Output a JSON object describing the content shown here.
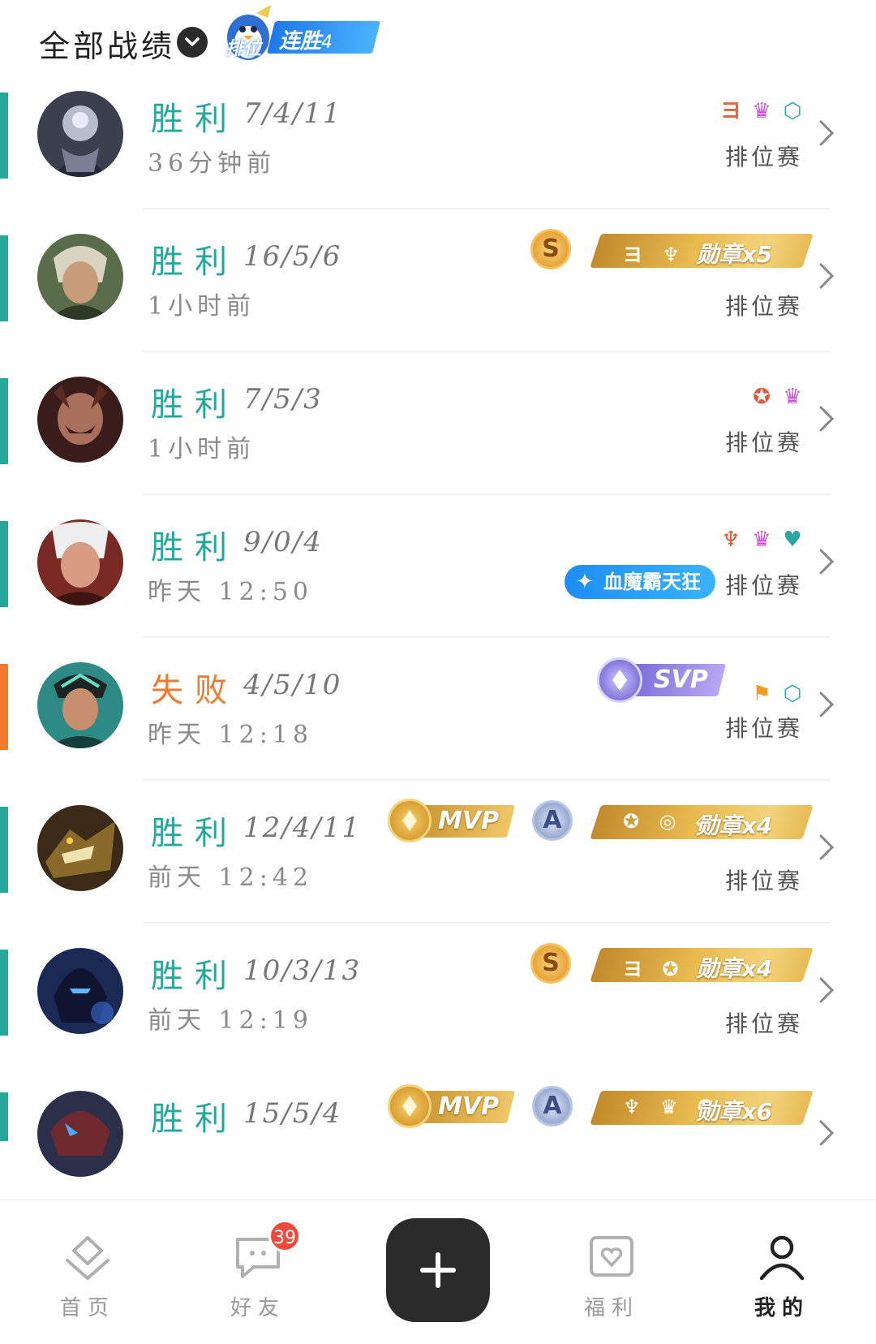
{
  "header": {
    "title": "全部战绩",
    "streak_rank_label": "排位",
    "streak_label": "连胜",
    "streak_count": "4"
  },
  "colors": {
    "win": "#25a89a",
    "loss": "#ef7a2e",
    "accent_gold": "#e7b44a",
    "title_pill": "#2a9df5"
  },
  "matches": [
    {
      "result": "胜利",
      "kda": "7/4/11",
      "time": "36分钟前",
      "mode": "排位赛",
      "outcome": "win",
      "small_icons": [
        "ヨ",
        "♛",
        "⬡"
      ],
      "grade": null,
      "medal": null,
      "mvp": null,
      "svp": null,
      "title": null
    },
    {
      "result": "胜利",
      "kda": "16/5/6",
      "time": "1小时前",
      "mode": "排位赛",
      "outcome": "win",
      "small_icons": [],
      "grade": "S",
      "medal": "勋章x5",
      "medal_icons": "ヨ ♆ ✪",
      "mvp": null,
      "svp": null,
      "title": null
    },
    {
      "result": "胜利",
      "kda": "7/5/3",
      "time": "1小时前",
      "mode": "排位赛",
      "outcome": "win",
      "small_icons": [
        "✪",
        "♛"
      ],
      "grade": null,
      "medal": null,
      "mvp": null,
      "svp": null,
      "title": null
    },
    {
      "result": "胜利",
      "kda": "9/0/4",
      "time": "昨天 12:50",
      "mode": "排位赛",
      "outcome": "win",
      "small_icons": [
        "♆",
        "♛",
        "♥"
      ],
      "grade": null,
      "medal": null,
      "mvp": null,
      "svp": null,
      "title": "血魔霸天狂"
    },
    {
      "result": "失败",
      "kda": "4/5/10",
      "time": "昨天 12:18",
      "mode": "排位赛",
      "outcome": "loss",
      "small_icons": [
        "⚑",
        "⬡"
      ],
      "grade": null,
      "medal": null,
      "mvp": null,
      "svp": "SVP",
      "title": null
    },
    {
      "result": "胜利",
      "kda": "12/4/11",
      "time": "前天 12:42",
      "mode": "排位赛",
      "outcome": "win",
      "small_icons": [],
      "grade": "A",
      "medal": "勋章x4",
      "medal_icons": "✪ ◎ ⬙",
      "mvp": "MVP",
      "svp": null,
      "title": null
    },
    {
      "result": "胜利",
      "kda": "10/3/13",
      "time": "前天 12:19",
      "mode": "排位赛",
      "outcome": "win",
      "small_icons": [],
      "grade": "S",
      "medal": "勋章x4",
      "medal_icons": "ヨ ✪ ♛",
      "mvp": null,
      "svp": null,
      "title": null
    },
    {
      "result": "胜利",
      "kda": "15/5/4",
      "time": "",
      "mode": "",
      "outcome": "win",
      "small_icons": [],
      "grade": "A",
      "medal": "勋章x6",
      "medal_icons": "♆ ♛ ✪",
      "mvp": "MVP",
      "svp": null,
      "title": null
    }
  ],
  "nav": {
    "home": "首页",
    "friends": "好友",
    "friends_badge": "39",
    "welfare": "福利",
    "me": "我的"
  }
}
